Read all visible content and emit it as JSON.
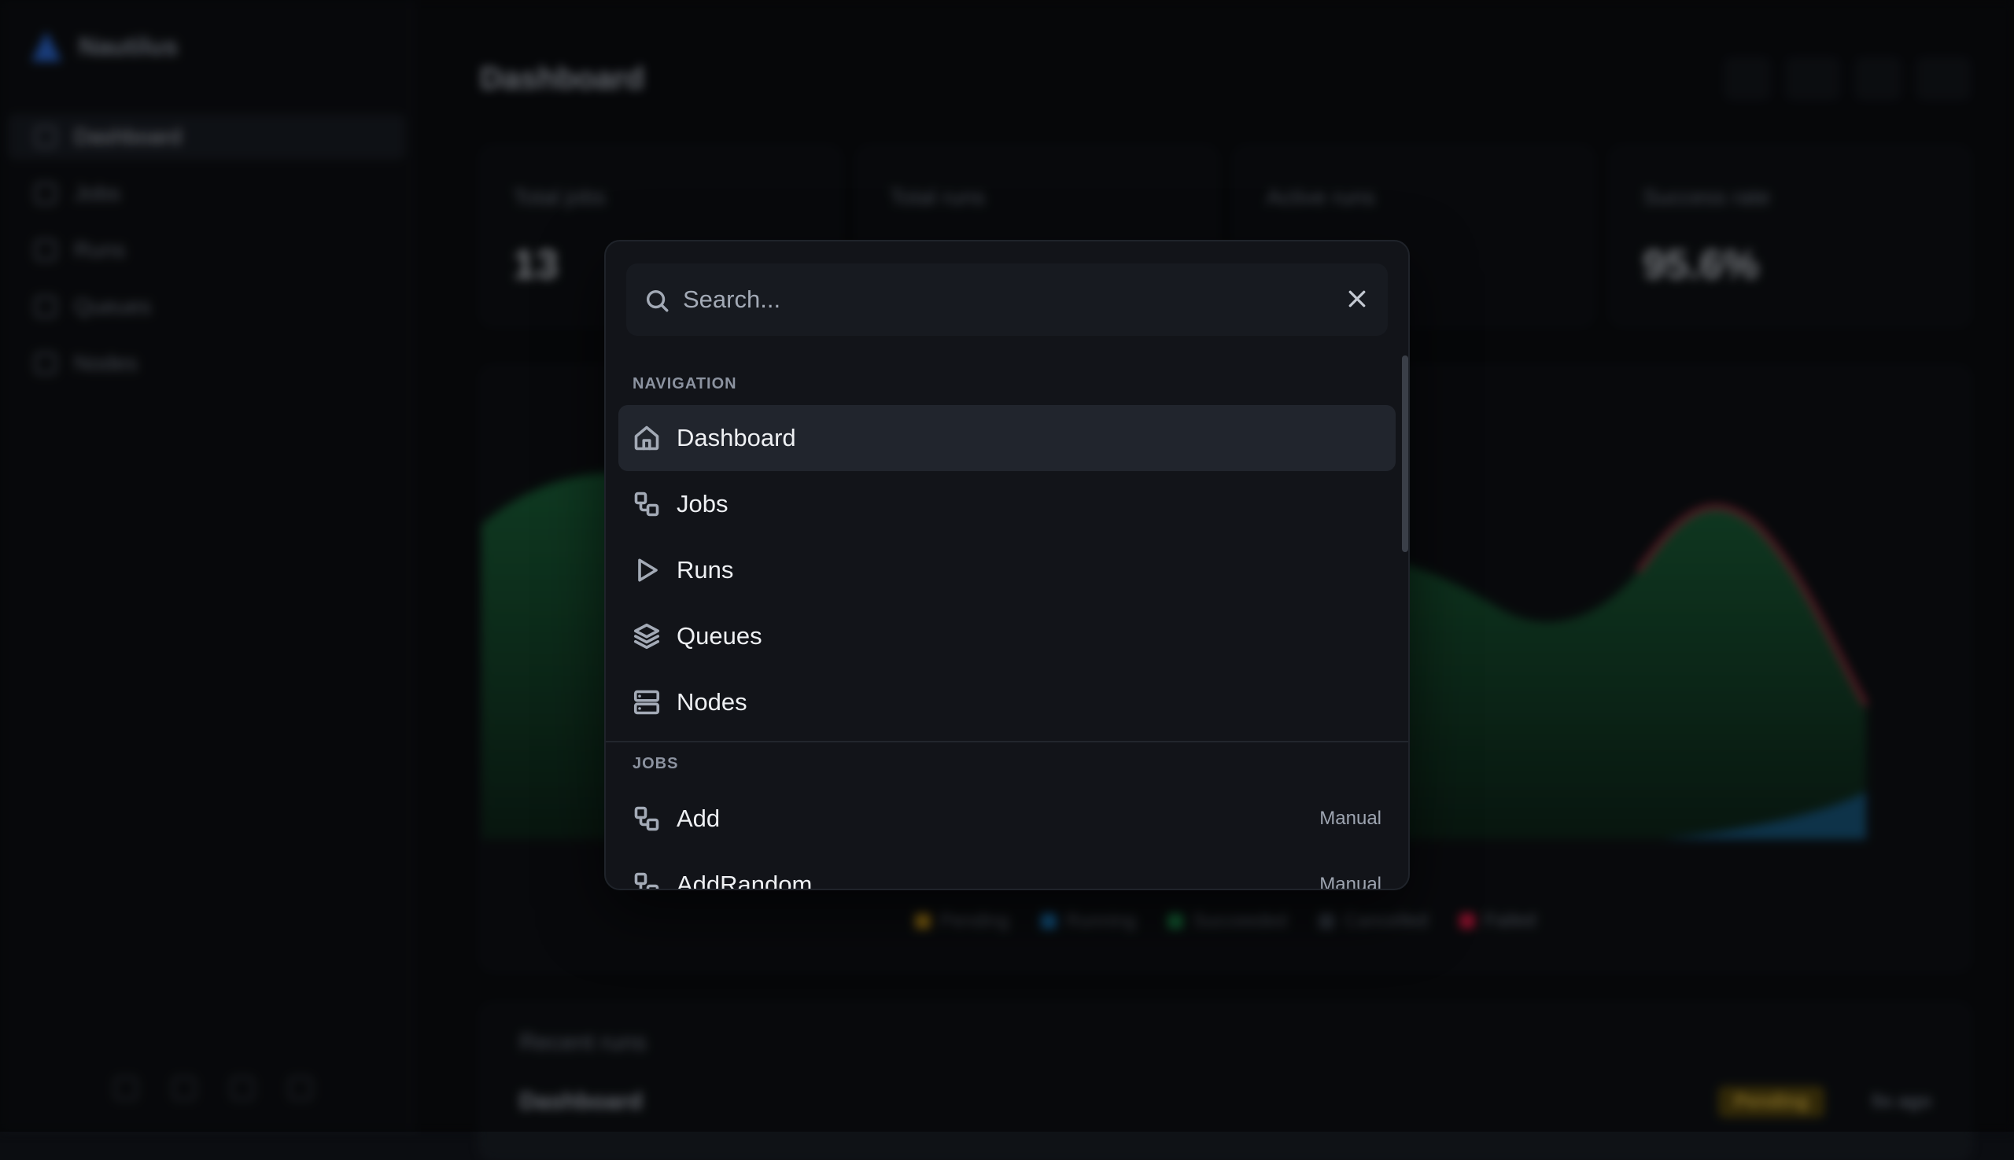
{
  "app": {
    "name": "Nautilus"
  },
  "sidebar": {
    "items": [
      {
        "label": "Dashboard"
      },
      {
        "label": "Jobs"
      },
      {
        "label": "Runs"
      },
      {
        "label": "Queues"
      },
      {
        "label": "Nodes"
      }
    ]
  },
  "page": {
    "title": "Dashboard"
  },
  "stats": [
    {
      "label": "Total jobs",
      "value": "13"
    },
    {
      "label": "Total runs",
      "value": ""
    },
    {
      "label": "Active runs",
      "value": ""
    },
    {
      "label": "Success rate",
      "value": "95.6%"
    }
  ],
  "chart": {
    "legend": [
      {
        "label": "Pending",
        "color": "#d9a21b"
      },
      {
        "label": "Running",
        "color": "#1e8ad6"
      },
      {
        "label": "Succeeded",
        "color": "#1f9d55"
      },
      {
        "label": "Cancelled",
        "color": "#4b5563"
      },
      {
        "label": "Failed",
        "color": "#e11d48"
      }
    ]
  },
  "recent": {
    "title": "Recent runs",
    "row": {
      "name": "Dashboard",
      "status": "Pending",
      "time": "5s ago"
    }
  },
  "palette": {
    "search": {
      "placeholder": "Search...",
      "value": ""
    },
    "groups": [
      {
        "label": "NAVIGATION",
        "items": [
          {
            "label": "Dashboard",
            "icon": "home-icon",
            "active": true
          },
          {
            "label": "Jobs",
            "icon": "workflow-icon"
          },
          {
            "label": "Runs",
            "icon": "play-icon"
          },
          {
            "label": "Queues",
            "icon": "layers-icon"
          },
          {
            "label": "Nodes",
            "icon": "server-icon"
          }
        ]
      },
      {
        "label": "JOBS",
        "items": [
          {
            "label": "Add",
            "meta": "Manual",
            "icon": "workflow-icon"
          },
          {
            "label": "AddRandom",
            "meta": "Manual",
            "icon": "workflow-icon"
          }
        ]
      }
    ]
  }
}
